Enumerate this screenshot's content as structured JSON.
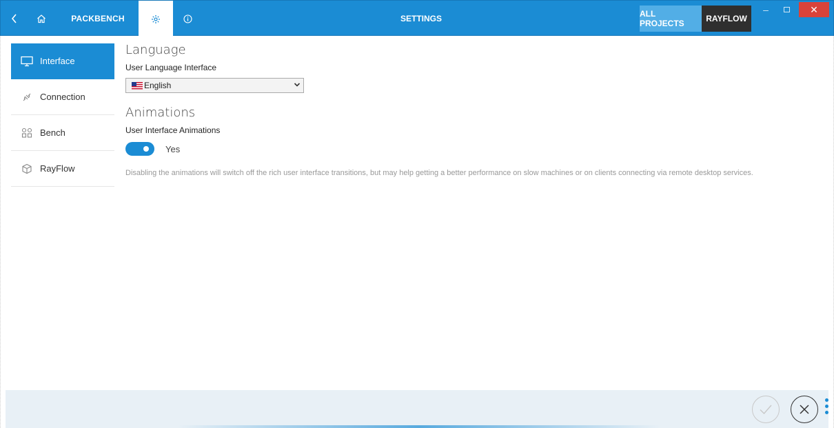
{
  "titlebar": {
    "app_name": "PACKBENCH",
    "title": "SETTINGS",
    "all_projects": "ALL PROJECTS",
    "project": "RAYFLOW",
    "minimize": "–",
    "close": "✕"
  },
  "sidebar": {
    "items": [
      {
        "label": "Interface",
        "icon": "monitor-icon",
        "active": true
      },
      {
        "label": "Connection",
        "icon": "plug-icon",
        "active": false
      },
      {
        "label": "Bench",
        "icon": "bench-icon",
        "active": false
      },
      {
        "label": "RayFlow",
        "icon": "cube-icon",
        "active": false
      }
    ]
  },
  "language": {
    "title": "Language",
    "field_label": "User Language Interface",
    "selected": "English"
  },
  "animations": {
    "title": "Animations",
    "field_label": "User Interface Animations",
    "toggle_on": true,
    "toggle_label": "Yes",
    "description": "Disabling the animations will switch off the rich user interface transitions, but may help getting a better performance on slow machines or on clients connecting via remote desktop services."
  },
  "colors": {
    "accent": "#1b8cd4",
    "dark_tab": "#2f2f2f",
    "close": "#d9433a"
  }
}
